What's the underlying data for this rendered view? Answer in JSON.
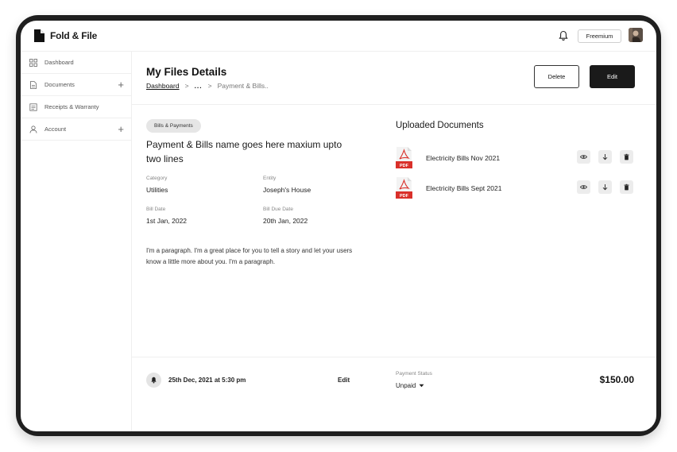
{
  "app": {
    "name": "Fold & File",
    "plan_label": "Freemium"
  },
  "sidebar": {
    "items": [
      {
        "label": "Dashboard",
        "icon": "grid-icon",
        "expandable": false
      },
      {
        "label": "Documents",
        "icon": "document-icon",
        "expandable": true
      },
      {
        "label": "Receipts & Warranty",
        "icon": "receipt-icon",
        "expandable": false
      },
      {
        "label": "Account",
        "icon": "user-icon",
        "expandable": true
      }
    ],
    "expand_symbol": "+"
  },
  "header": {
    "title": "My Files Details",
    "breadcrumb": {
      "root": "Dashboard",
      "separator": ">",
      "ellipsis": "...",
      "current": "Payment & Bills.."
    },
    "delete_label": "Delete",
    "edit_label": "Edit"
  },
  "details": {
    "tag": "Bills & Payments",
    "name": "Payment & Bills name goes here maxium upto two lines",
    "fields": {
      "category": {
        "label": "Category",
        "value": "Utilities"
      },
      "entity": {
        "label": "Entity",
        "value": "Joseph's House"
      },
      "bill_date": {
        "label": "Bill Date",
        "value": "1st Jan, 2022"
      },
      "due_date": {
        "label": "Bill Due Date",
        "value": "20th Jan, 2022"
      }
    },
    "paragraph": "I'm a paragraph. I'm a great place for you to tell a story and let your users know a little more about you. I'm a paragraph."
  },
  "documents": {
    "title": "Uploaded Documents",
    "file_badge": "PDF",
    "items": [
      {
        "name": "Electricity Bills Nov 2021"
      },
      {
        "name": "Electricity Bills Sept 2021"
      }
    ]
  },
  "footer": {
    "reminder": "25th Dec, 2021 at 5:30 pm",
    "edit_label": "Edit",
    "payment_status_label": "Payment Status",
    "payment_status_value": "Unpaid",
    "amount": "$150.00"
  },
  "colors": {
    "primary_dark": "#1a1a1a",
    "pdf_red": "#d9302a",
    "device_frame": "#1f1f1f"
  }
}
